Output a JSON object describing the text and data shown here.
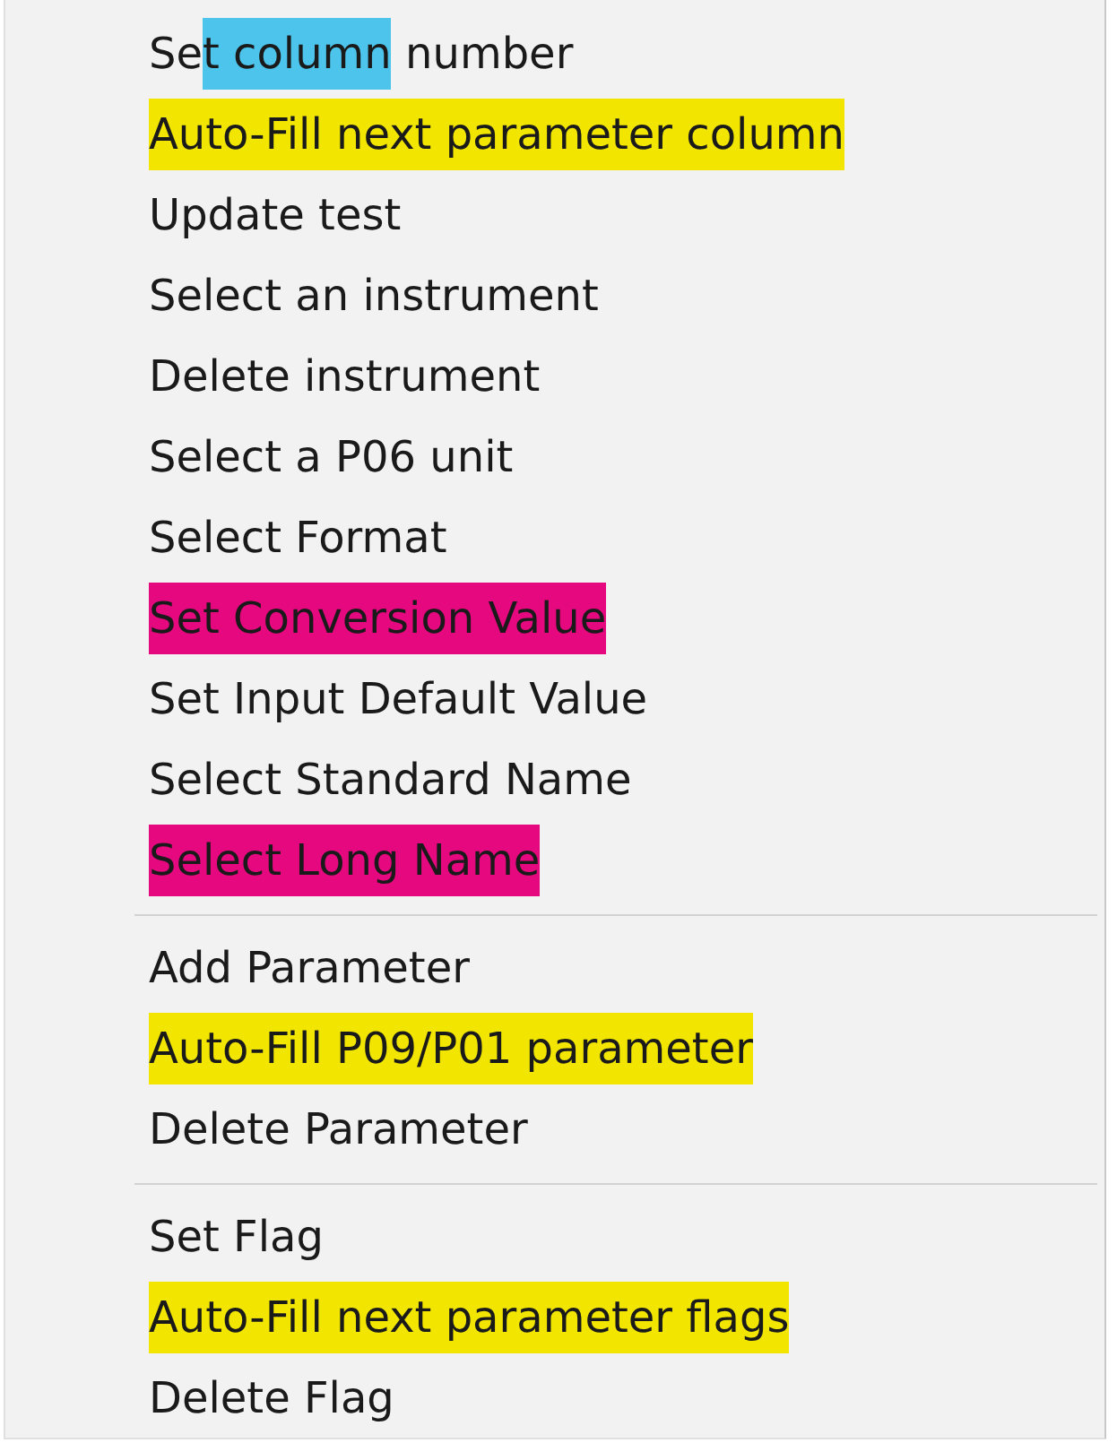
{
  "menu": {
    "groups": [
      {
        "items": [
          {
            "parts": [
              {
                "text": "Se"
              },
              {
                "text": "t column",
                "color": "#4cc4ec"
              },
              {
                "text": " number"
              }
            ]
          },
          {
            "parts": [
              {
                "text": "Auto-Fill next parameter column",
                "color": "#f2e600"
              }
            ]
          },
          {
            "parts": [
              {
                "text": "Update test"
              }
            ]
          },
          {
            "parts": [
              {
                "text": "Select an instrument"
              }
            ]
          },
          {
            "parts": [
              {
                "text": "Delete instrument"
              }
            ]
          },
          {
            "parts": [
              {
                "text": "Select a P06 unit"
              }
            ]
          },
          {
            "parts": [
              {
                "text": "Select Format"
              }
            ]
          },
          {
            "parts": [
              {
                "text": "Set Conversion Value",
                "color": "#e6087f"
              }
            ]
          },
          {
            "parts": [
              {
                "text": "Set Input Default Value"
              }
            ]
          },
          {
            "parts": [
              {
                "text": "Select Standard Name"
              }
            ]
          },
          {
            "parts": [
              {
                "text": "Select Long Name",
                "color": "#e6087f"
              }
            ]
          }
        ]
      },
      {
        "items": [
          {
            "parts": [
              {
                "text": "Add Parameter"
              }
            ]
          },
          {
            "parts": [
              {
                "text": "Auto-Fill P09/P01 parameter",
                "color": "#f2e600"
              }
            ]
          },
          {
            "parts": [
              {
                "text": "Delete Parameter"
              }
            ]
          }
        ]
      },
      {
        "items": [
          {
            "parts": [
              {
                "text": "Set Flag"
              }
            ]
          },
          {
            "parts": [
              {
                "text": "Auto-Fill next parameter flags",
                "color": "#f2e600"
              }
            ]
          },
          {
            "parts": [
              {
                "text": "Delete Flag"
              }
            ]
          }
        ]
      }
    ]
  }
}
